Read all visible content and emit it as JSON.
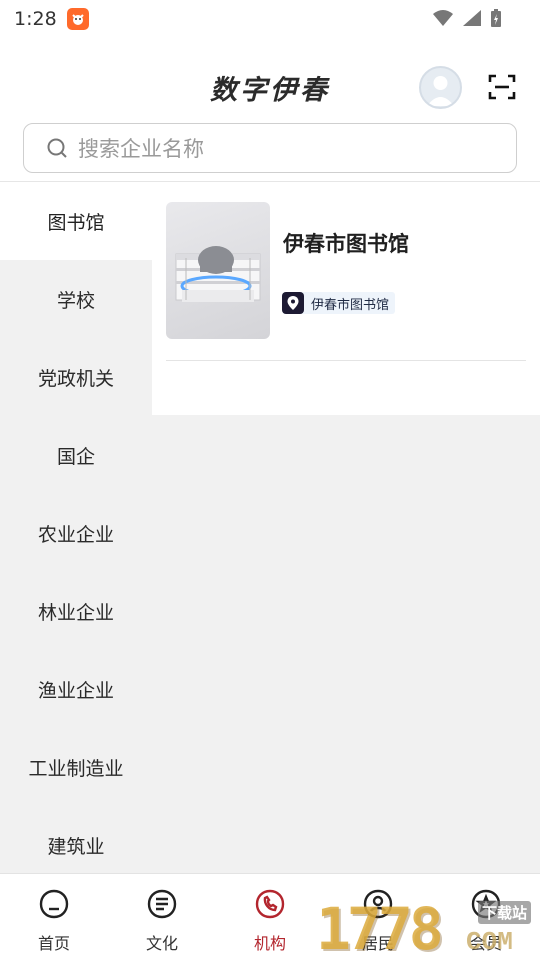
{
  "status_bar": {
    "time": "1:28"
  },
  "header": {
    "title": "数字伊春"
  },
  "search": {
    "placeholder": "搜索企业名称"
  },
  "sidebar": {
    "items": [
      {
        "label": "图书馆",
        "active": true
      },
      {
        "label": "学校"
      },
      {
        "label": "党政机关"
      },
      {
        "label": "国企"
      },
      {
        "label": "农业企业"
      },
      {
        "label": "林业企业"
      },
      {
        "label": "渔业企业"
      },
      {
        "label": "工业制造业"
      },
      {
        "label": "建筑业"
      }
    ]
  },
  "results": [
    {
      "title": "伊春市图书馆",
      "tag": "伊春市图书馆"
    }
  ],
  "bottom_nav": {
    "items": [
      {
        "label": "首页",
        "icon": "home-icon"
      },
      {
        "label": "文化",
        "icon": "culture-icon"
      },
      {
        "label": "机构",
        "icon": "institution-icon",
        "active": true
      },
      {
        "label": "居民",
        "icon": "resident-icon"
      },
      {
        "label": "会员",
        "icon": "member-icon"
      }
    ]
  },
  "watermark": {
    "digits": "1778",
    "suffix": "COM",
    "site": "下载站"
  },
  "colors": {
    "accent": "#b3262e",
    "sidebar_bg": "#f1f1f1",
    "text": "#222222"
  }
}
